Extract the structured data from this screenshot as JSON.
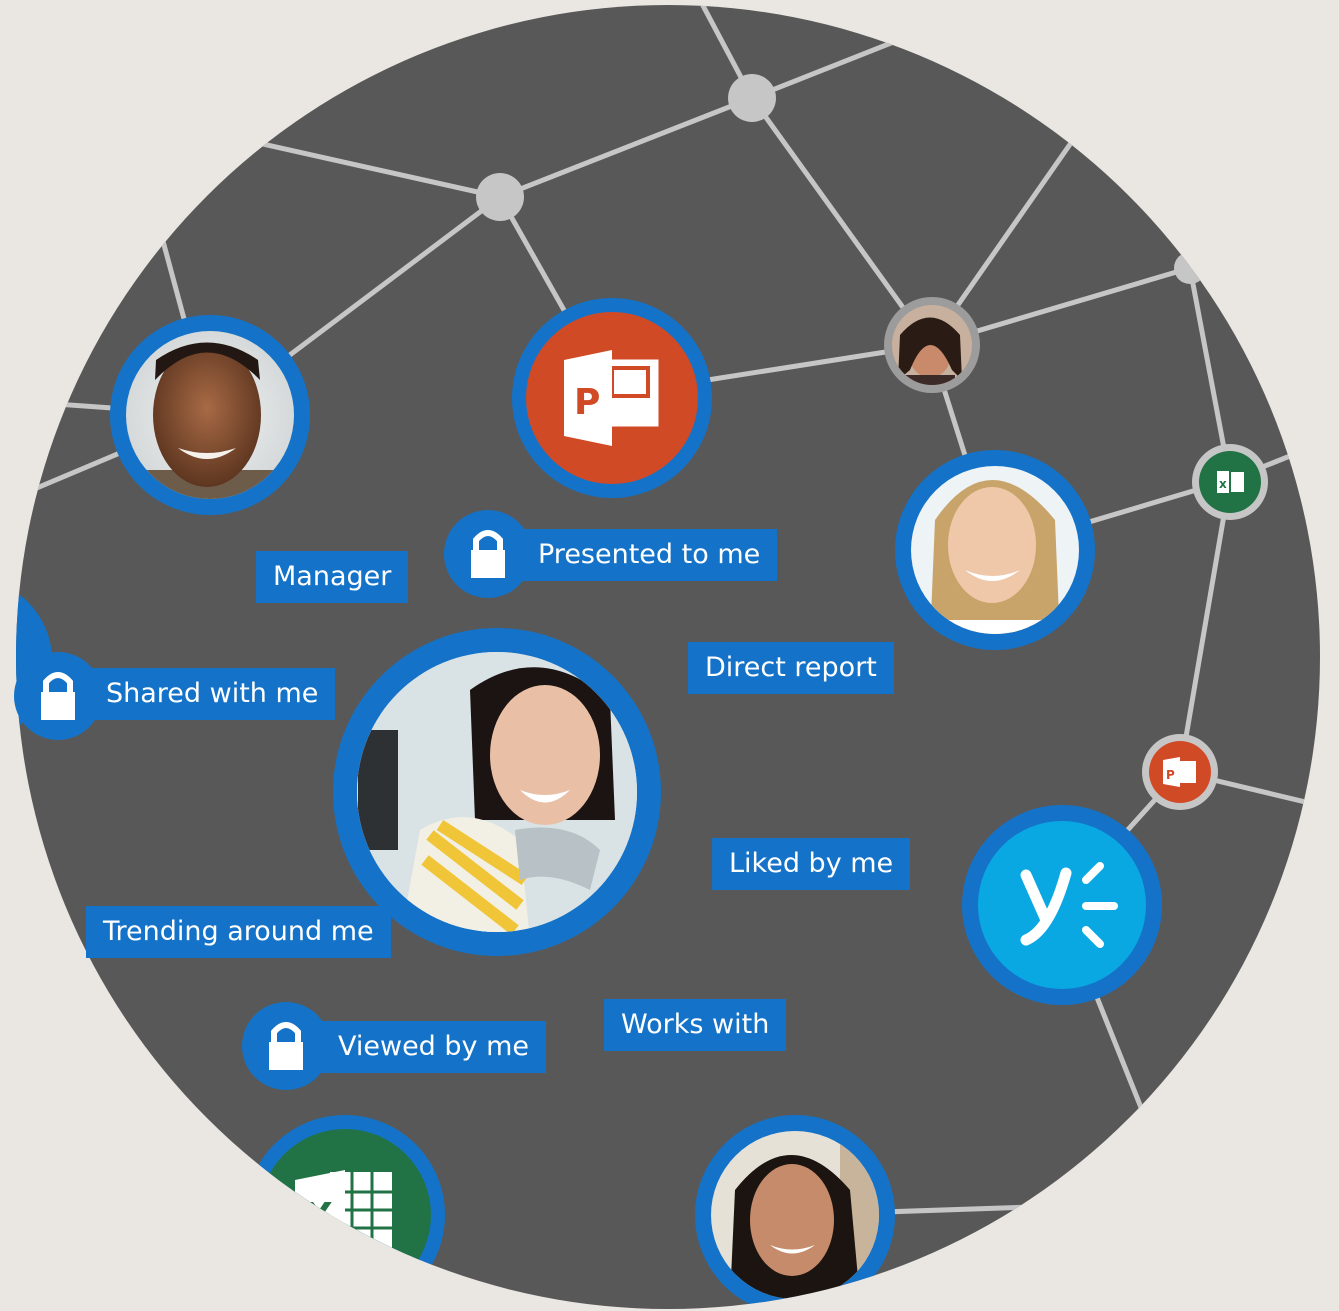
{
  "graph": {
    "relationship_labels": {
      "manager": "Manager",
      "presented_to_me": "Presented to me",
      "shared_with_me": "Shared with me",
      "direct_report": "Direct report",
      "liked_by_me": "Liked by me",
      "trending_around_me": "Trending around me",
      "viewed_by_me": "Viewed by me",
      "works_with": "Works with"
    },
    "icons": {
      "powerpoint": "powerpoint-icon",
      "excel": "excel-icon",
      "yammer": "yammer-icon",
      "lock": "lock-icon"
    },
    "colors": {
      "disc": "#585858",
      "background": "#eae7e3",
      "accent_blue": "#1473c8",
      "powerpoint": "#d04a26",
      "excel": "#217346",
      "yammer": "#0aa8e2",
      "edge": "#c6c6c6"
    }
  }
}
